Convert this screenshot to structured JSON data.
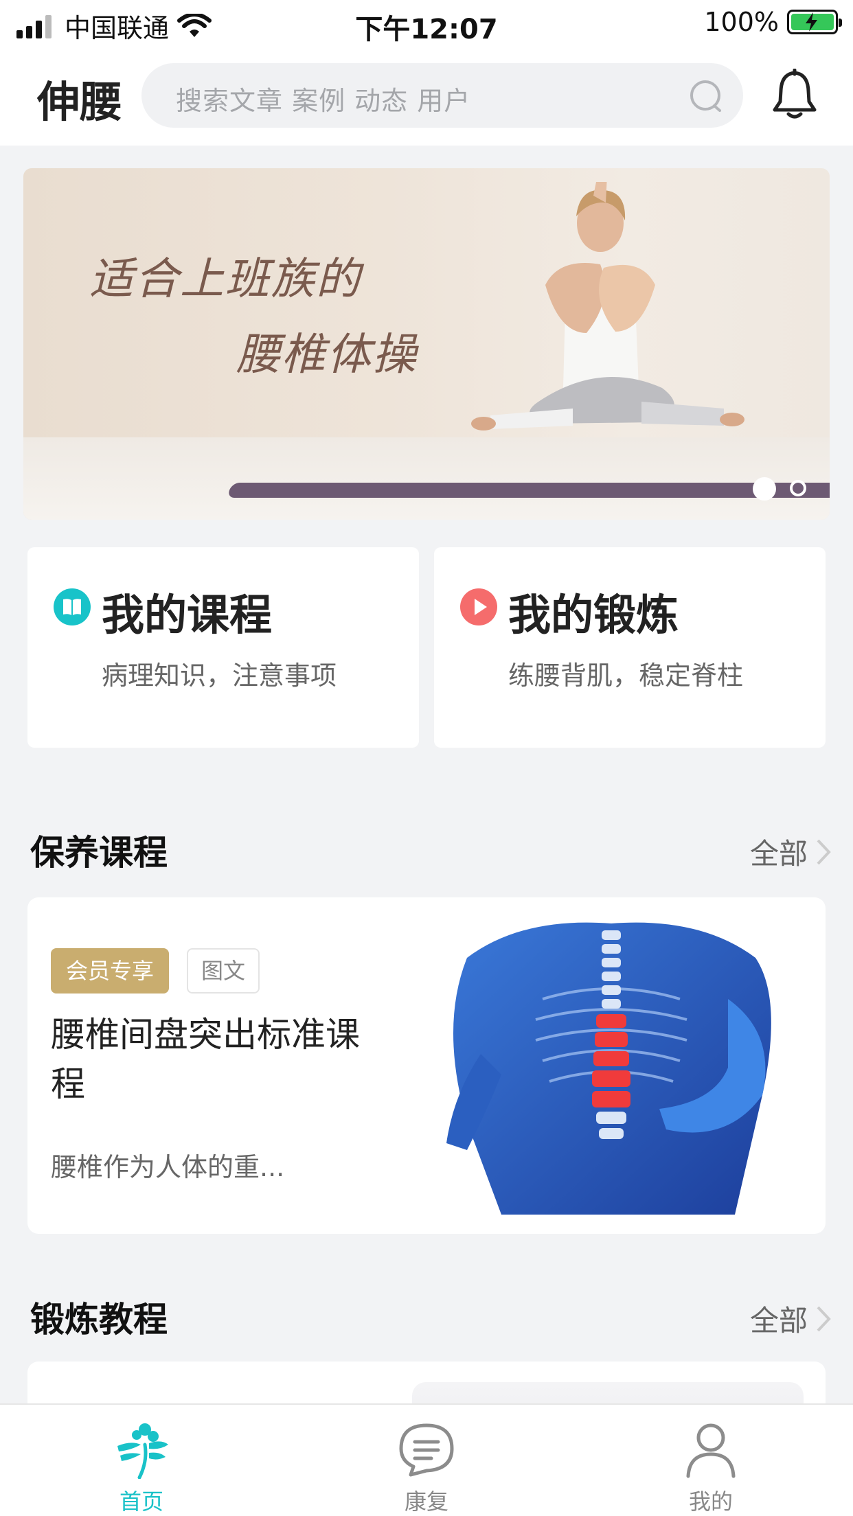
{
  "status_bar": {
    "carrier": "中国联通",
    "time": "下午12:07",
    "battery": "100%"
  },
  "header": {
    "app_title": "伸腰",
    "search_placeholder": "搜索文章 案例 动态 用户"
  },
  "banner": {
    "line1": "适合上班族的",
    "line2": "腰椎体操",
    "slide_count": 2,
    "active_slide": 1
  },
  "quick_cards": [
    {
      "title": "我的课程",
      "subtitle": "病理知识，注意事项",
      "icon": "book-icon",
      "color": "#18c3c9"
    },
    {
      "title": "我的锻炼",
      "subtitle": "练腰背肌，稳定脊柱",
      "icon": "play-icon",
      "color": "#f56c6c"
    }
  ],
  "sections": {
    "courses": {
      "title": "保养课程",
      "more": "全部"
    },
    "exercise": {
      "title": "锻炼教程",
      "more": "全部"
    }
  },
  "course_card": {
    "badge_vip": "会员专享",
    "badge_type": "图文",
    "title": "腰椎间盘突出标准课程",
    "desc": "腰椎作为人体的重..."
  },
  "tabbar": {
    "items": [
      {
        "label": "首页",
        "active": true
      },
      {
        "label": "康复",
        "active": false
      },
      {
        "label": "我的",
        "active": false
      }
    ],
    "accent": "#19c2c8"
  }
}
